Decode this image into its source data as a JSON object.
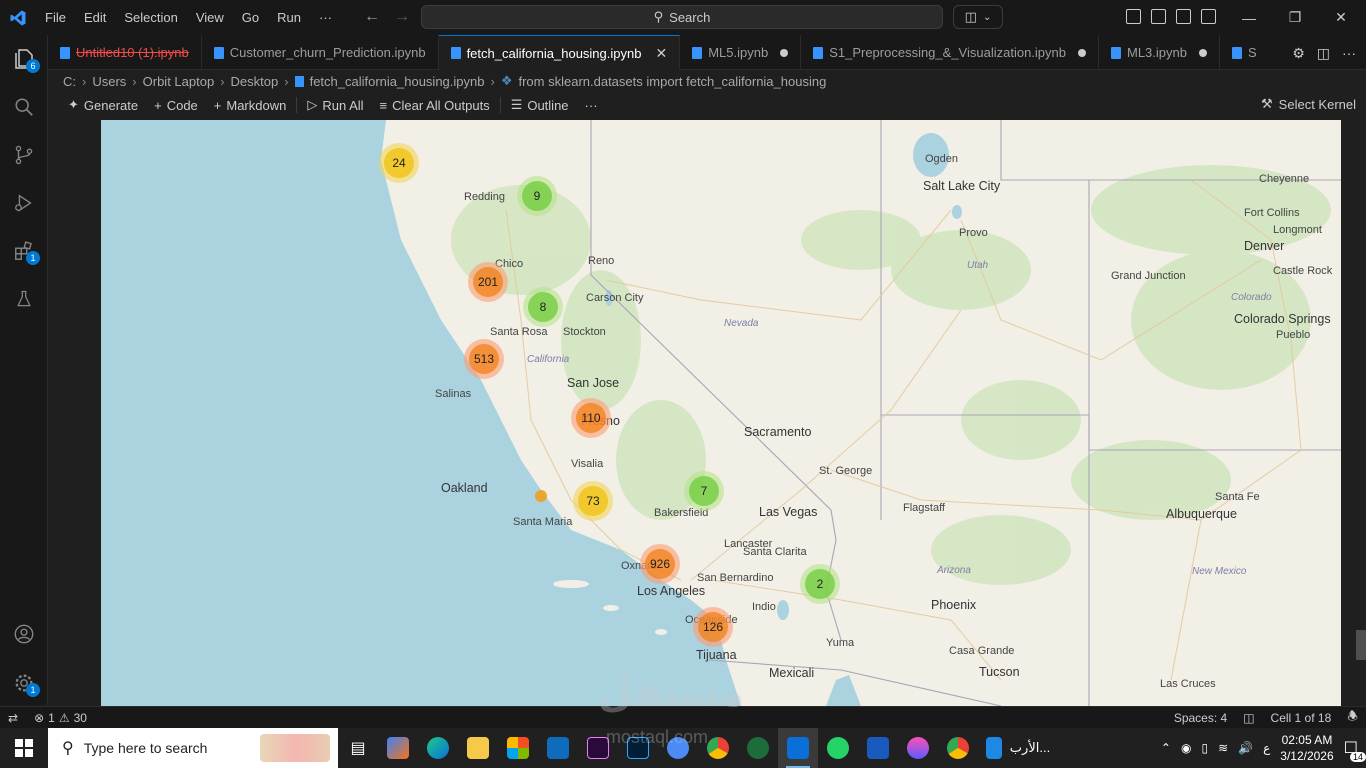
{
  "titlebar": {
    "menu": [
      "File",
      "Edit",
      "Selection",
      "View",
      "Go",
      "Run",
      "···"
    ],
    "search_label": "Search",
    "window_controls": [
      "—",
      "❐",
      "✕"
    ]
  },
  "activitybar": {
    "explorer_badge": "6",
    "extensions_badge": "1",
    "settings_badge": "1"
  },
  "tabs": [
    {
      "label": "Untitled10 (1).ipynb",
      "state": "error",
      "dirty": false
    },
    {
      "label": "Customer_churn_Prediction.ipynb",
      "state": "normal",
      "dirty": false
    },
    {
      "label": "fetch_california_housing.ipynb",
      "state": "active",
      "dirty": false
    },
    {
      "label": "ML5.ipynb",
      "state": "normal",
      "dirty": true
    },
    {
      "label": "S1_Preprocessing_&_Visualization.ipynb",
      "state": "normal",
      "dirty": true
    },
    {
      "label": "ML3.ipynb",
      "state": "normal",
      "dirty": true
    },
    {
      "label": "S",
      "state": "normal",
      "dirty": false
    }
  ],
  "breadcrumb": [
    "C:",
    "Users",
    "Orbit Laptop",
    "Desktop",
    "fetch_california_housing.ipynb",
    "from sklearn.datasets import fetch_california_housing"
  ],
  "notebook_toolbar": {
    "generate": "Generate",
    "code": "Code",
    "markdown": "Markdown",
    "run_all": "Run All",
    "clear_outputs": "Clear All Outputs",
    "outline": "Outline",
    "more": "···",
    "select_kernel": "Select Kernel"
  },
  "map": {
    "places": [
      {
        "name": "Ogden",
        "cls": ""
      },
      {
        "name": "Salt Lake City",
        "cls": "big"
      },
      {
        "name": "Provo",
        "cls": ""
      },
      {
        "name": "Utah",
        "cls": "state"
      },
      {
        "name": "Cheyenne",
        "cls": ""
      },
      {
        "name": "Fort Collins",
        "cls": ""
      },
      {
        "name": "Longmont",
        "cls": ""
      },
      {
        "name": "Denver",
        "cls": "big"
      },
      {
        "name": "Castle Rock",
        "cls": ""
      },
      {
        "name": "Colorado",
        "cls": "state"
      },
      {
        "name": "Colorado Springs",
        "cls": "big"
      },
      {
        "name": "Pueblo",
        "cls": ""
      },
      {
        "name": "Grand Junction",
        "cls": ""
      },
      {
        "name": "Redding",
        "cls": ""
      },
      {
        "name": "Reno",
        "cls": ""
      },
      {
        "name": "Chico",
        "cls": ""
      },
      {
        "name": "Carson City",
        "cls": ""
      },
      {
        "name": "Nevada",
        "cls": "state"
      },
      {
        "name": "Sacramento",
        "cls": "big"
      },
      {
        "name": "Santa Rosa",
        "cls": ""
      },
      {
        "name": "Oakland",
        "cls": "big"
      },
      {
        "name": "Stockton",
        "cls": ""
      },
      {
        "name": "San Jose",
        "cls": "big"
      },
      {
        "name": "California",
        "cls": "state"
      },
      {
        "name": "Salinas",
        "cls": ""
      },
      {
        "name": "Fresno",
        "cls": "big"
      },
      {
        "name": "Visalia",
        "cls": ""
      },
      {
        "name": "St. George",
        "cls": ""
      },
      {
        "name": "Las Vegas",
        "cls": "big"
      },
      {
        "name": "Bakersfield",
        "cls": ""
      },
      {
        "name": "Santa Maria",
        "cls": ""
      },
      {
        "name": "Lancaster",
        "cls": ""
      },
      {
        "name": "Santa Clarita",
        "cls": ""
      },
      {
        "name": "Oxnard",
        "cls": ""
      },
      {
        "name": "San Bernardino",
        "cls": ""
      },
      {
        "name": "Los Angeles",
        "cls": "big"
      },
      {
        "name": "Indio",
        "cls": ""
      },
      {
        "name": "Oceanside",
        "cls": ""
      },
      {
        "name": "Tijuana",
        "cls": "big"
      },
      {
        "name": "Mexicali",
        "cls": "big"
      },
      {
        "name": "Yuma",
        "cls": ""
      },
      {
        "name": "Flagstaff",
        "cls": ""
      },
      {
        "name": "Arizona",
        "cls": "state"
      },
      {
        "name": "Phoenix",
        "cls": "big"
      },
      {
        "name": "Casa Grande",
        "cls": ""
      },
      {
        "name": "Tucson",
        "cls": "big"
      },
      {
        "name": "Santa Fe",
        "cls": ""
      },
      {
        "name": "Albuquerque",
        "cls": "big"
      },
      {
        "name": "New Mexico",
        "cls": "state"
      },
      {
        "name": "Las Cruces",
        "cls": ""
      }
    ],
    "clusters": [
      {
        "count": "24",
        "color": "yellow"
      },
      {
        "count": "9",
        "color": "green"
      },
      {
        "count": "201",
        "color": "orange"
      },
      {
        "count": "8",
        "color": "green"
      },
      {
        "count": "513",
        "color": "orange"
      },
      {
        "count": "110",
        "color": "orange"
      },
      {
        "count": "73",
        "color": "yellow"
      },
      {
        "count": "7",
        "color": "green"
      },
      {
        "count": "926",
        "color": "orange"
      },
      {
        "count": "2",
        "color": "green"
      },
      {
        "count": "126",
        "color": "orange"
      }
    ],
    "colors": {
      "water": "#aad3df",
      "land": "#efede6",
      "border": "#a9a4b7"
    }
  },
  "statusbar": {
    "errors": "1",
    "warnings": "30",
    "spaces": "Spaces: 4",
    "cell": "Cell 1 of 18"
  },
  "taskbar": {
    "search_placeholder": "Type here to search",
    "notification_count": "14",
    "lang": "ع",
    "time": "02:05 AM",
    "date": "3/12/2026",
    "arabic_app_label": "الأرب..."
  },
  "watermark": {
    "logo_text": "مستقل",
    "site": "mostaql.com"
  }
}
